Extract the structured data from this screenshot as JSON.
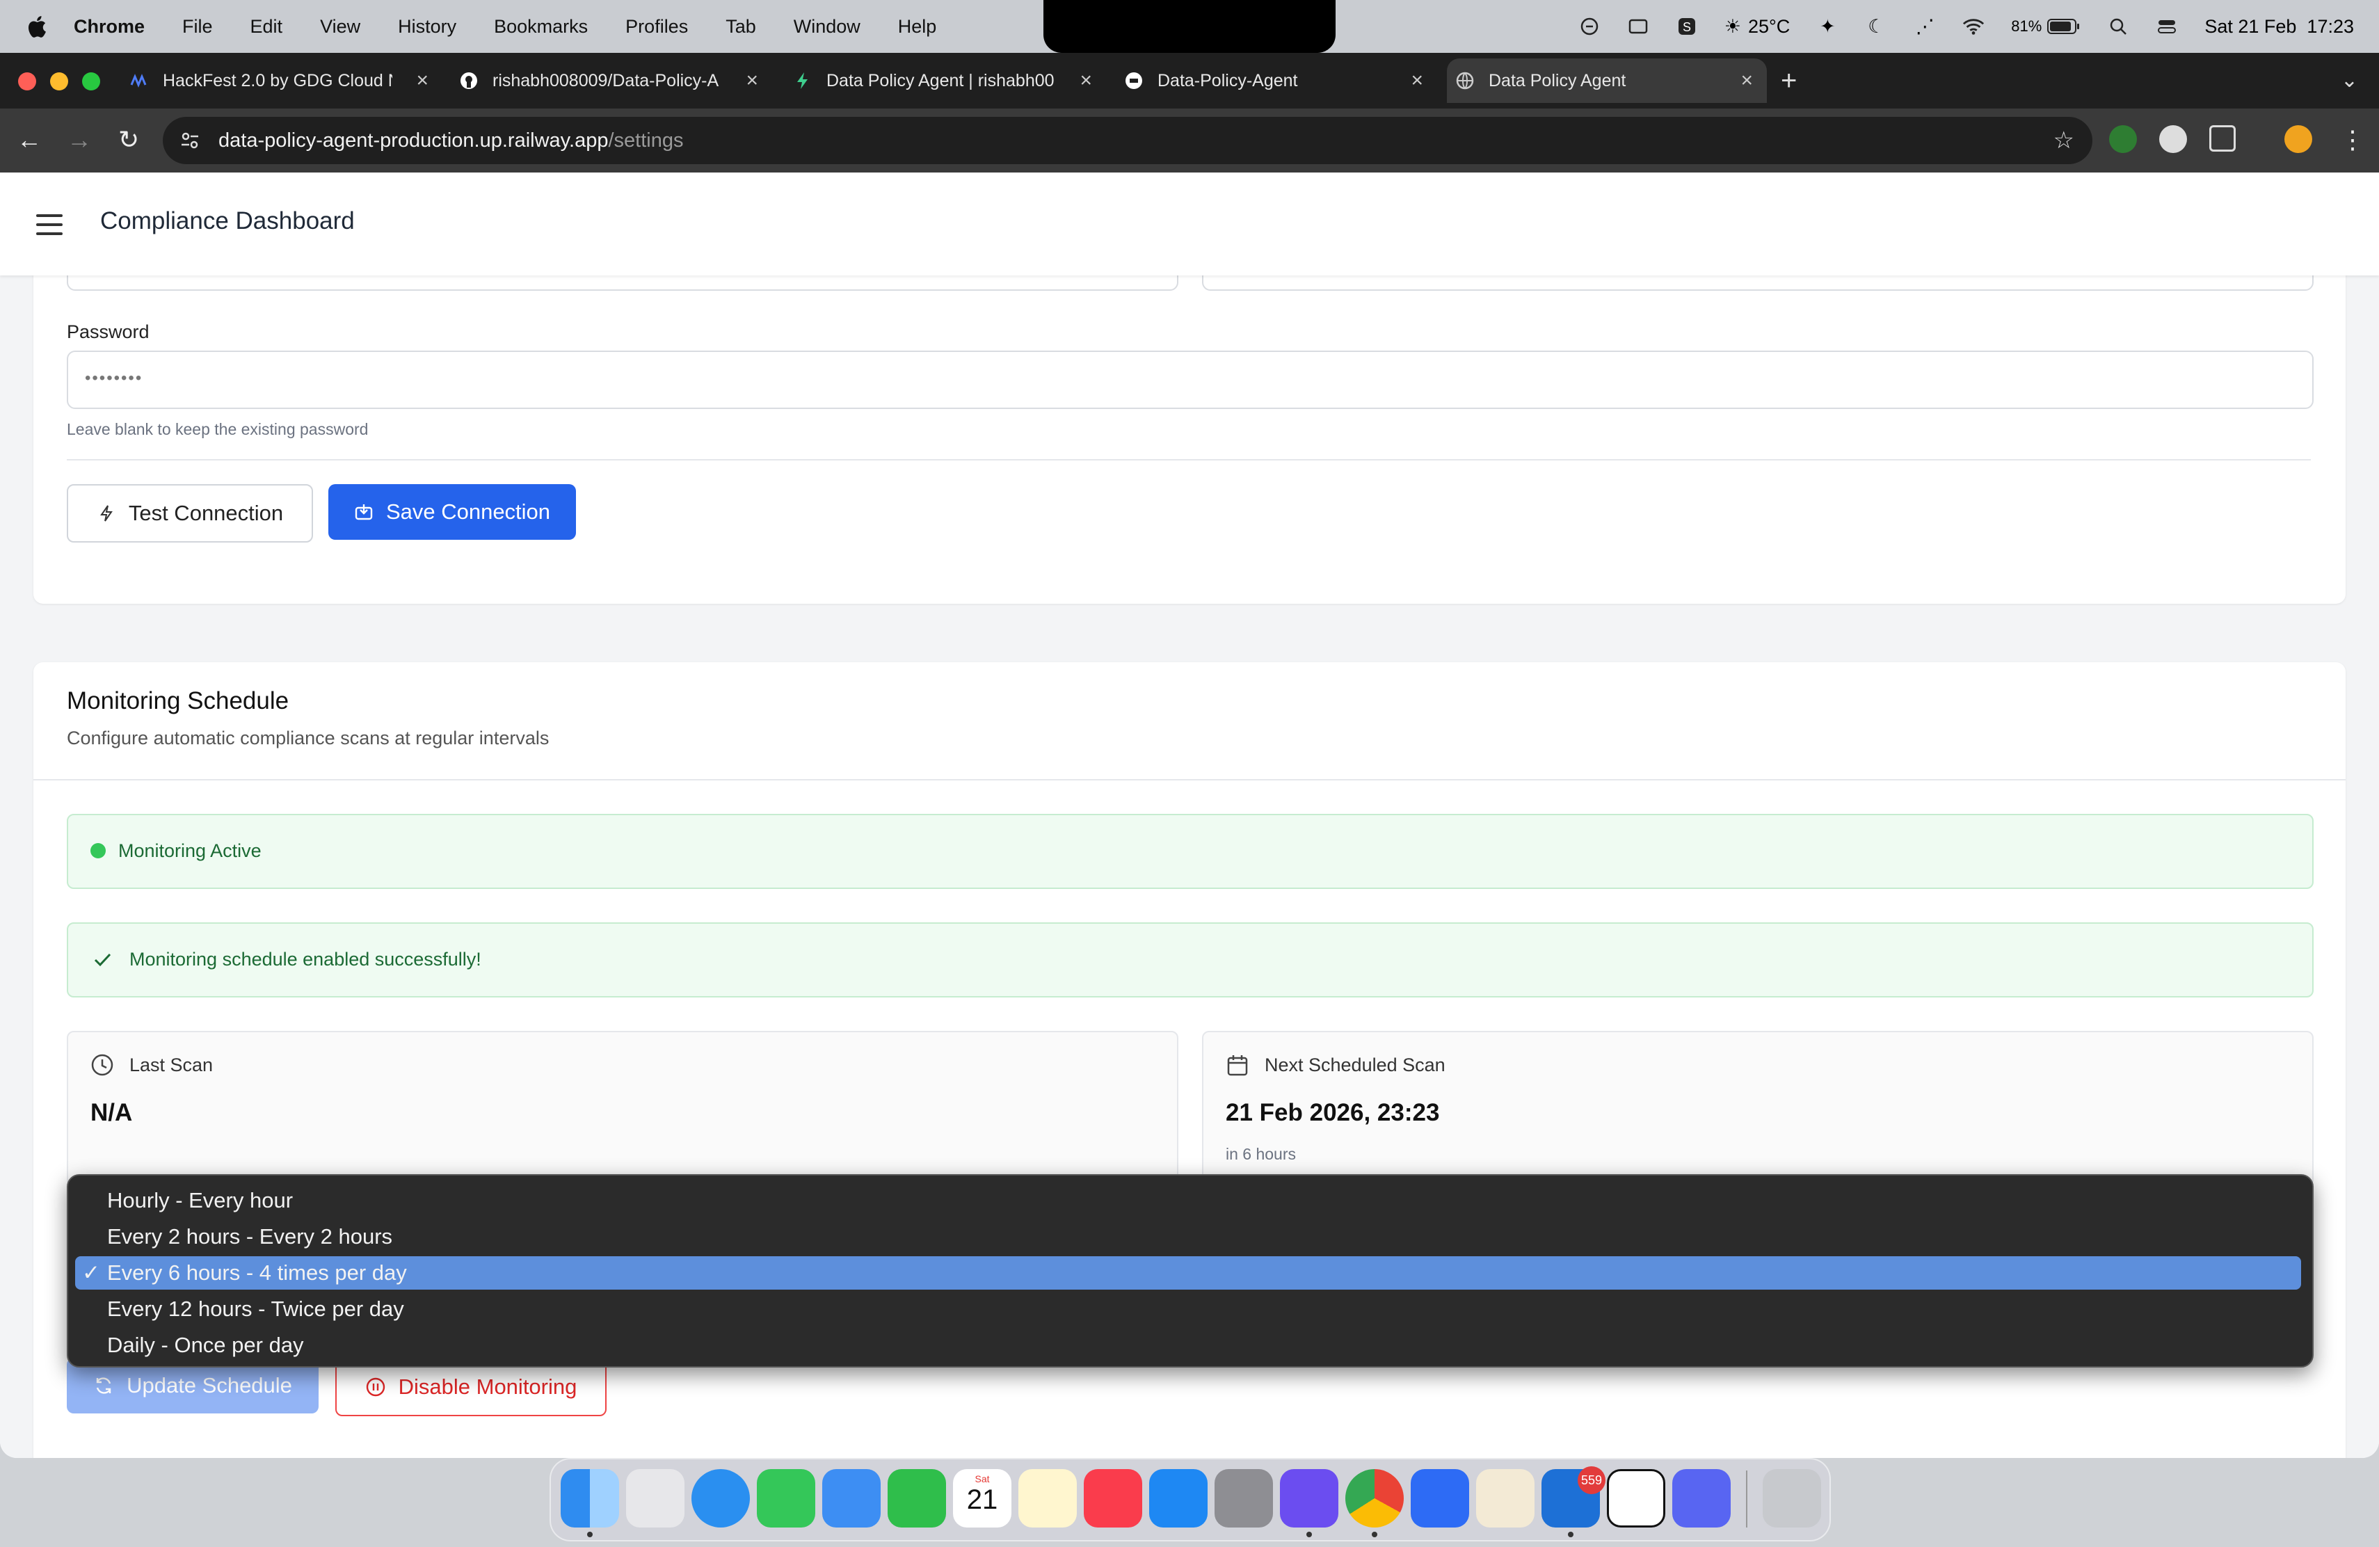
{
  "menubar": {
    "app": "Chrome",
    "items": [
      "File",
      "Edit",
      "View",
      "History",
      "Bookmarks",
      "Profiles",
      "Tab",
      "Window",
      "Help"
    ],
    "weather": "25°C",
    "battery": "81%",
    "datetime": "Sat 21 Feb  17:23"
  },
  "tabs": [
    {
      "title": "HackFest 2.0 by GDG Cloud N"
    },
    {
      "title": "rishabh008009/Data-Policy-A"
    },
    {
      "title": "Data Policy Agent | rishabh00"
    },
    {
      "title": "Data-Policy-Agent"
    },
    {
      "title": "Data Policy Agent"
    }
  ],
  "address": {
    "host": "data-policy-agent-production.up.railway.app",
    "path": "/settings"
  },
  "app": {
    "title": "Compliance Dashboard"
  },
  "connection": {
    "password_label": "Password",
    "password_value": "••••••••",
    "password_hint": "Leave blank to keep the existing password",
    "test_button": "Test Connection",
    "save_button": "Save Connection"
  },
  "monitoring": {
    "title": "Monitoring Schedule",
    "subtitle": "Configure automatic compliance scans at regular intervals",
    "status": "Monitoring Active",
    "success": "Monitoring schedule enabled successfully!",
    "last_scan_label": "Last Scan",
    "last_scan_value": "N/A",
    "next_scan_label": "Next Scheduled Scan",
    "next_scan_value": "21 Feb 2026, 23:23",
    "next_scan_relative": "in 6 hours",
    "options": [
      "Hourly - Every hour",
      "Every 2 hours - Every 2 hours",
      "Every 6 hours - 4 times per day",
      "Every 12 hours - Twice per day",
      "Daily - Once per day"
    ],
    "selected_option": "Every 6 hours - 4 times per day",
    "update_button": "Update Schedule",
    "disable_button": "Disable Monitoring"
  },
  "dock": {
    "calendar_day": "Sat",
    "calendar_date": "21",
    "mail_badge": "559"
  },
  "colors": {
    "primary": "#2563eb",
    "success_bg": "#effbf2",
    "success_text": "#1b6a34",
    "danger": "#dc2626",
    "selected_option": "#5d8fdc"
  }
}
